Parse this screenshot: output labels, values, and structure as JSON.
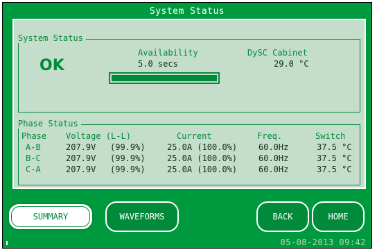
{
  "title": "System Status",
  "system_status": {
    "legend": "System Status",
    "state": "OK",
    "availability_label": "Availability",
    "availability_value": "5.0 secs",
    "availability_fraction": 1.0,
    "cabinet_label": "DySC Cabinet",
    "cabinet_temp": "29.0 °C"
  },
  "phase_status": {
    "legend": "Phase Status",
    "headers": {
      "phase": "Phase",
      "voltage": "Voltage (L-L)",
      "current": "Current",
      "freq": "Freq.",
      "switch": "Switch"
    },
    "rows": [
      {
        "phase": "A-B",
        "voltage": "207.9V",
        "voltage_pct": "(99.9%)",
        "current": "25.0A (100.0%)",
        "freq": "60.0Hz",
        "switch": "37.5 °C"
      },
      {
        "phase": "B-C",
        "voltage": "207.9V",
        "voltage_pct": "(99.9%)",
        "current": "25.0A (100.0%)",
        "freq": "60.0Hz",
        "switch": "37.5 °C"
      },
      {
        "phase": "C-A",
        "voltage": "207.9V",
        "voltage_pct": "(99.9%)",
        "current": "25.0A (100.0%)",
        "freq": "60.0Hz",
        "switch": "37.5 °C"
      }
    ]
  },
  "buttons": {
    "summary": "SUMMARY",
    "waveforms": "WAVEFORMS",
    "back": "BACK",
    "home": "HOME"
  },
  "datetime": "05-08-2013 09:42",
  "colors": {
    "frame_green": "#009a3e",
    "panel_bg": "#c5decb",
    "accent_green": "#008a3a"
  }
}
